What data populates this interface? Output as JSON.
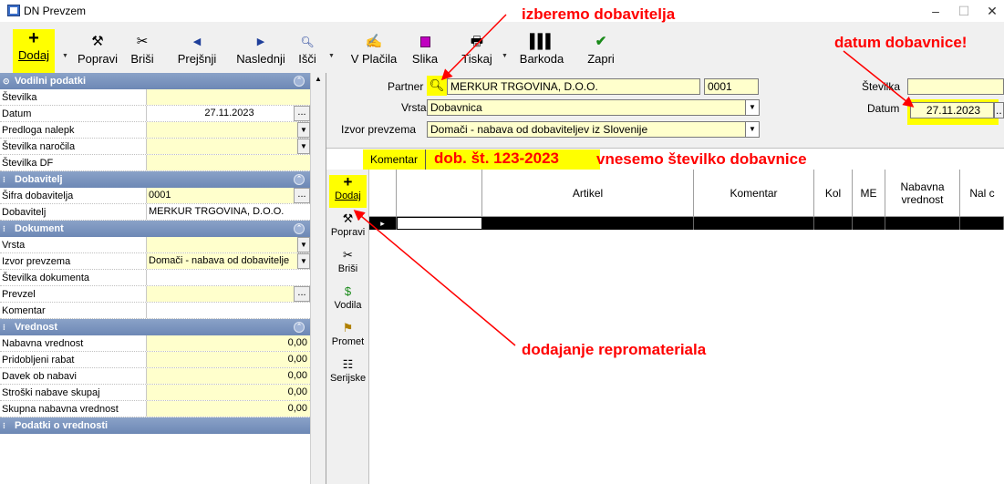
{
  "window": {
    "title": "DN Prevzem",
    "minimize": "–",
    "maximize": "☐",
    "close": "✕"
  },
  "toolbar": {
    "dodaj": "Dodaj",
    "popravi": "Popravi",
    "brisi": "Briši",
    "prejsnji": "Prejšnji",
    "naslednji": "Naslednji",
    "isci": "Išči",
    "vplacila": "V Plačila",
    "slika": "Slika",
    "tiskaj": "Tiskaj",
    "barkoda": "Barkoda",
    "zapri": "Zapri"
  },
  "left": {
    "sections": {
      "vodilni": "Vodilni podatki",
      "dobavitelj": "Dobavitelj",
      "dokument": "Dokument",
      "vrednost": "Vrednost",
      "bottom": "Podatki o vrednosti"
    },
    "labels": {
      "stevilka": "Številka",
      "datum": "Datum",
      "predloga": "Predloga nalepk",
      "narocila": "Številka naročila",
      "df": "Številka DF",
      "sifra": "Šifra dobavitelja",
      "dobavitelj": "Dobavitelj",
      "vrsta": "Vrsta",
      "izvor": "Izvor prevzema",
      "stdok": "Številka dokumenta",
      "prevzel": "Prevzel",
      "komentar": "Komentar",
      "nabavna": "Nabavna vrednost",
      "rabat": "Pridobljeni rabat",
      "davek": "Davek ob nabavi",
      "stroski": "Stroški nabave skupaj",
      "skupna": "Skupna nabavna vrednost"
    },
    "values": {
      "datum": "27.11.2023",
      "sifra": "0001",
      "dobavitelj": "MERKUR TRGOVINA, D.O.O.",
      "izvor": "Domači - nabava od dobavitelje",
      "nabavna": "0,00",
      "rabat": "0,00",
      "davek": "0,00",
      "stroski": "0,00",
      "skupna": "0,00"
    }
  },
  "header": {
    "partner_label": "Partner",
    "partner_value": "MERKUR TRGOVINA, D.O.O.",
    "partner_code": "0001",
    "vrsta_label": "Vrsta",
    "vrsta_value": "Dobavnica",
    "izvor_label": "Izvor prevzema",
    "izvor_value": "Domači - nabava od dobaviteljev iz Slovenije",
    "stevilka_label": "Številka",
    "datum_label": "Datum",
    "datum_value": "27.11.2023",
    "komentar_label": "Komentar",
    "komentar_value": "dob. št. 123-2023"
  },
  "side_tools": {
    "dodaj": "Dodaj",
    "popravi": "Popravi",
    "brisi": "Briši",
    "vodila": "Vodila",
    "promet": "Promet",
    "serijske": "Serijske"
  },
  "grid": {
    "columns": [
      "Artikel",
      "Komentar",
      "Kol",
      "ME",
      "Nabavna vrednost",
      "Nal c"
    ],
    "row_marker": "▸"
  },
  "annotations": {
    "dobavitelj": "izberemo dobavitelja",
    "datum": "datum dobavnice!",
    "komentar": "vnesemo številko dobavnice",
    "repro": "dodajanje repromateriala"
  },
  "colors": {
    "highlight": "#ffff00",
    "field_yellow": "#ffffcc",
    "section_blue": "#7a93bf",
    "annotation_red": "#ff0000"
  }
}
